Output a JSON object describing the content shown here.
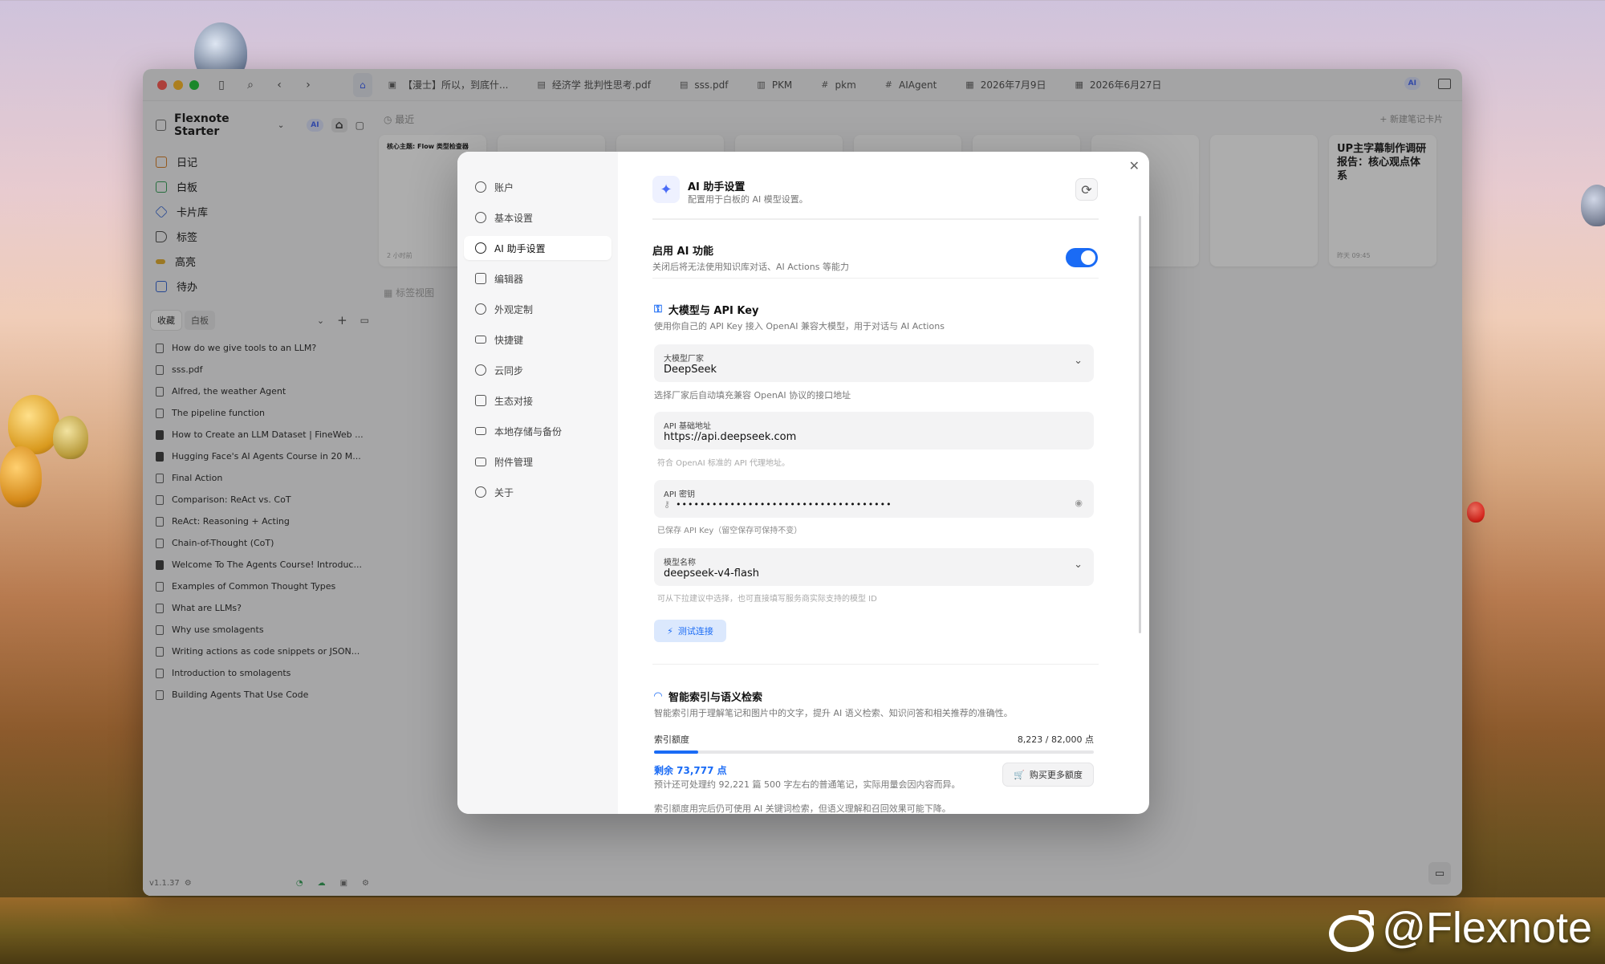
{
  "colors": {
    "accent": "#1a6bf5",
    "toggle_on": "#1a6bf5"
  },
  "titlebar": {
    "tabs": [
      {
        "icon": "book-icon",
        "label": "【漫士】所以，到底什..."
      },
      {
        "icon": "pdf-icon",
        "label": "经济学 批判性思考.pdf"
      },
      {
        "icon": "pdf-icon",
        "label": "sss.pdf"
      },
      {
        "icon": "book-icon",
        "label": "PKM"
      },
      {
        "icon": "hash-icon",
        "label": "pkm"
      },
      {
        "icon": "hash-icon",
        "label": "AIAgent"
      },
      {
        "icon": "calendar-icon",
        "label": "2026年7月9日"
      },
      {
        "icon": "calendar-icon",
        "label": "2026年6月27日"
      }
    ],
    "ai_badge": "AI"
  },
  "sidebar": {
    "workspace": "Flexnote Starter",
    "ai_badge": "AI",
    "nav": [
      "日记",
      "白板",
      "卡片库",
      "标签",
      "高亮",
      "待办"
    ],
    "fav_tabs": [
      "收藏",
      "白板"
    ],
    "docs": [
      "How do we give tools to an LLM?",
      "sss.pdf",
      "Alfred, the weather Agent",
      "The pipeline function",
      "How to Create an LLM Dataset | FineWeb ...",
      "Hugging Face's AI Agents Course in 20 M...",
      "Final Action",
      "Comparison: ReAct vs. CoT",
      "ReAct: Reasoning + Acting",
      "Chain-of-Thought (CoT)",
      "Welcome To The Agents Course! Introduc...",
      "Examples of Common Thought Types",
      "What are LLMs?",
      "Why use smolagents",
      "Writing actions as code snippets or JSON...",
      "Introduction to smolagents",
      "Building Agents That Use Code"
    ],
    "version": "v1.1.37"
  },
  "main": {
    "recent_label": "最近",
    "new_card_label": "+ 新建笔记卡片",
    "tag_view_label": "标签视图",
    "cards": [
      {
        "title": "核心主题: Flow 类型检查器",
        "time": "2 小时前"
      },
      {
        "title": "UP主字幕制作调研报告：核心观点体系",
        "time": "昨天 09:45"
      }
    ]
  },
  "modal": {
    "nav": [
      "账户",
      "基本设置",
      "AI 助手设置",
      "编辑器",
      "外观定制",
      "快捷键",
      "云同步",
      "生态对接",
      "本地存储与备份",
      "附件管理",
      "关于"
    ],
    "active_nav_index": 2,
    "header": {
      "title": "AI 助手设置",
      "subtitle": "配置用于白板的 AI 模型设置。"
    },
    "enable_ai": {
      "label": "启用 AI 功能",
      "desc": "关闭后将无法使用知识库对话、AI Actions 等能力",
      "enabled": true
    },
    "llm_section": {
      "title": "大模型与 API Key",
      "desc": "使用你自己的 API Key 接入 OpenAI 兼容大模型，用于对话与 AI Actions",
      "provider_label": "大模型厂家",
      "provider_value": "DeepSeek",
      "provider_hint": "选择厂家后自动填充兼容 OpenAI 协议的接口地址",
      "base_url_label": "API 基础地址",
      "base_url_value": "https://api.deepseek.com",
      "base_url_hint": "符合 OpenAI 标准的 API 代理地址。",
      "api_key_label": "API 密钥",
      "api_key_value": "••••••••••••••••••••••••••••••••••••",
      "api_key_hint": "已保存 API Key（留空保存可保持不变）",
      "model_label": "模型名称",
      "model_value": "deepseek-v4-flash",
      "model_hint": "可从下拉建议中选择，也可直接填写服务商实际支持的模型 ID",
      "test_button": "测试连接"
    },
    "index_section": {
      "title": "智能索引与语义检索",
      "desc": "智能索引用于理解笔记和图片中的文字，提升 AI 语义检索、知识问答和相关推荐的准确性。",
      "quota_label": "索引额度",
      "quota_value": "8,223 / 82,000 点",
      "quota_used": 8223,
      "quota_total": 82000,
      "remaining": "剩余 73,777 点",
      "estimate": "预计还可处理约 92,221 篇 500 字左右的普通笔记，实际用量会因内容而异。",
      "buy_button": "购买更多额度",
      "footnote": "索引额度用完后仍可使用 AI 关键词检索，但语义理解和召回效果可能下降。"
    }
  },
  "watermark": "@Flexnote"
}
